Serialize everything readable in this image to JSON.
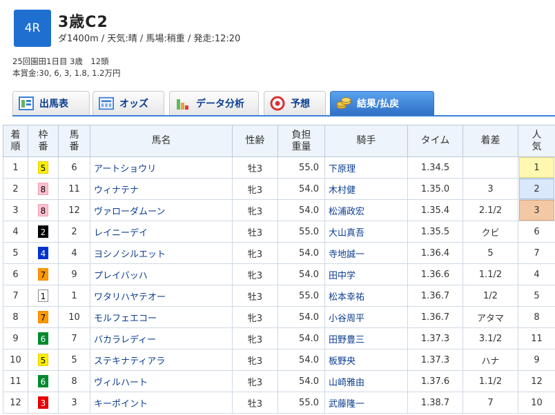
{
  "race": {
    "number": "4R",
    "title": "3歳C2",
    "conditions": "ダ1400m / 天気:晴 / 馬場:稍重 / 発走:12:20",
    "meta_line1": "25回園田1日目 3歳　12頭",
    "meta_line2": "本賞金:30, 6, 3, 1.8, 1.2万円"
  },
  "tabs": [
    {
      "label": "出馬表",
      "icon": "entry-table-icon"
    },
    {
      "label": "オッズ",
      "icon": "odds-icon"
    },
    {
      "label": "データ分析",
      "icon": "bar-chart-icon"
    },
    {
      "label": "予想",
      "icon": "target-icon"
    },
    {
      "label": "結果/払戻",
      "icon": "coins-icon"
    }
  ],
  "headers": {
    "rank": [
      "着",
      "順"
    ],
    "waku": [
      "枠",
      "番"
    ],
    "uma": [
      "馬",
      "番"
    ],
    "name": "馬名",
    "sex_age": "性齢",
    "weight": [
      "負担",
      "重量"
    ],
    "jockey": "騎手",
    "time": "タイム",
    "margin": "着差",
    "pop": [
      "人",
      "気"
    ]
  },
  "waku_colors": {
    "1": {
      "bg": "#ffffff",
      "fg": "#000000",
      "border": "#888888"
    },
    "2": {
      "bg": "#000000",
      "fg": "#ffffff",
      "border": "#000000"
    },
    "3": {
      "bg": "#e60000",
      "fg": "#ffffff",
      "border": "#e60000"
    },
    "4": {
      "bg": "#0033cc",
      "fg": "#ffffff",
      "border": "#0033cc"
    },
    "5": {
      "bg": "#ffee00",
      "fg": "#000000",
      "border": "#e0d000"
    },
    "6": {
      "bg": "#008a2e",
      "fg": "#ffffff",
      "border": "#008a2e"
    },
    "7": {
      "bg": "#ff9900",
      "fg": "#000000",
      "border": "#ee8800"
    },
    "8": {
      "bg": "#ffbfd0",
      "fg": "#000000",
      "border": "#f0a0b5"
    }
  },
  "rows": [
    {
      "rank": "1",
      "waku": "5",
      "uma": "6",
      "name": "アートショウリ",
      "sex_age": "牡3",
      "weight": "55.0",
      "jockey": "下原理",
      "time": "1.34.5",
      "margin": "",
      "pop": "1"
    },
    {
      "rank": "2",
      "waku": "8",
      "uma": "11",
      "name": "ウィナテナ",
      "sex_age": "牝3",
      "weight": "54.0",
      "jockey": "木村健",
      "time": "1.35.0",
      "margin": "3",
      "pop": "2"
    },
    {
      "rank": "3",
      "waku": "8",
      "uma": "12",
      "name": "ヴァローダムーン",
      "sex_age": "牝3",
      "weight": "54.0",
      "jockey": "松浦政宏",
      "time": "1.35.4",
      "margin": "2.1/2",
      "pop": "3"
    },
    {
      "rank": "4",
      "waku": "2",
      "uma": "2",
      "name": "レイニーデイ",
      "sex_age": "牡3",
      "weight": "55.0",
      "jockey": "大山真吾",
      "time": "1.35.5",
      "margin": "クビ",
      "pop": "6"
    },
    {
      "rank": "5",
      "waku": "4",
      "uma": "4",
      "name": "ヨシノシルエット",
      "sex_age": "牝3",
      "weight": "54.0",
      "jockey": "寺地誠一",
      "time": "1.36.4",
      "margin": "5",
      "pop": "7"
    },
    {
      "rank": "6",
      "waku": "7",
      "uma": "9",
      "name": "プレイバッハ",
      "sex_age": "牝3",
      "weight": "54.0",
      "jockey": "田中学",
      "time": "1.36.6",
      "margin": "1.1/2",
      "pop": "4"
    },
    {
      "rank": "7",
      "waku": "1",
      "uma": "1",
      "name": "ワタリハヤテオー",
      "sex_age": "牡3",
      "weight": "55.0",
      "jockey": "松本幸祐",
      "time": "1.36.7",
      "margin": "1/2",
      "pop": "5"
    },
    {
      "rank": "8",
      "waku": "7",
      "uma": "10",
      "name": "モルフェエコー",
      "sex_age": "牝3",
      "weight": "54.0",
      "jockey": "小谷周平",
      "time": "1.36.7",
      "margin": "アタマ",
      "pop": "8"
    },
    {
      "rank": "9",
      "waku": "6",
      "uma": "7",
      "name": "バカラレディー",
      "sex_age": "牝3",
      "weight": "54.0",
      "jockey": "田野豊三",
      "time": "1.37.3",
      "margin": "3.1/2",
      "pop": "11"
    },
    {
      "rank": "10",
      "waku": "5",
      "uma": "5",
      "name": "ステキナティアラ",
      "sex_age": "牝3",
      "weight": "54.0",
      "jockey": "板野央",
      "time": "1.37.3",
      "margin": "ハナ",
      "pop": "9"
    },
    {
      "rank": "11",
      "waku": "6",
      "uma": "8",
      "name": "ヴィルハート",
      "sex_age": "牝3",
      "weight": "54.0",
      "jockey": "山崎雅由",
      "time": "1.37.6",
      "margin": "1.1/2",
      "pop": "12"
    },
    {
      "rank": "12",
      "waku": "3",
      "uma": "3",
      "name": "キーポイント",
      "sex_age": "牡3",
      "weight": "55.0",
      "jockey": "武藤隆一",
      "time": "1.38.7",
      "margin": "7",
      "pop": "10"
    }
  ]
}
